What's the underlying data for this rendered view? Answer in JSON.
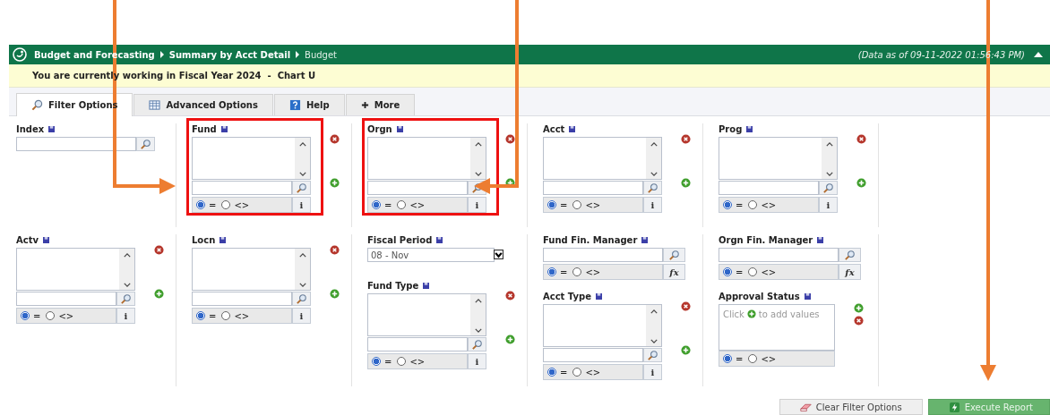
{
  "header": {
    "breadcrumb": [
      {
        "label": "Budget and Forecasting"
      },
      {
        "label": "Summary by Acct Detail"
      },
      {
        "label": "Budget"
      }
    ],
    "timestamp": "(Data as of 09-11-2022 01:56:43 PM)"
  },
  "notice": "You are currently working in Fiscal Year 2024  -  Chart U",
  "tabs": [
    {
      "kind": "filter",
      "label": "Filter Options",
      "selected": true
    },
    {
      "kind": "advanced",
      "label": "Advanced Options",
      "selected": false
    },
    {
      "kind": "help",
      "label": "Help",
      "selected": false
    },
    {
      "kind": "more",
      "label": "More",
      "selected": false
    }
  ],
  "rows": [
    {
      "cells": [
        {
          "filters": [
            {
              "kind": "lookup",
              "label": "Index"
            }
          ]
        },
        {
          "filters": [
            {
              "kind": "list",
              "label": "Fund",
              "highlighted": true,
              "operators": [
                {
                  "label": "=",
                  "selected": true
                },
                {
                  "label": "<>",
                  "selected": false
                }
              ],
              "info_button": "i"
            }
          ]
        },
        {
          "filters": [
            {
              "kind": "list",
              "label": "Orgn",
              "highlighted": true,
              "operators": [
                {
                  "label": "=",
                  "selected": true
                },
                {
                  "label": "<>",
                  "selected": false
                }
              ],
              "info_button": "i"
            }
          ]
        },
        {
          "filters": [
            {
              "kind": "list",
              "label": "Acct",
              "highlighted": false,
              "operators": [
                {
                  "label": "=",
                  "selected": true
                },
                {
                  "label": "<>",
                  "selected": false
                }
              ],
              "info_button": "i"
            }
          ]
        },
        {
          "filters": [
            {
              "kind": "list",
              "label": "Prog",
              "highlighted": false,
              "operators": [
                {
                  "label": "=",
                  "selected": true
                },
                {
                  "label": "<>",
                  "selected": false
                }
              ],
              "info_button": "i"
            }
          ]
        }
      ]
    },
    {
      "cells": [
        {
          "filters": [
            {
              "kind": "list",
              "label": "Actv",
              "highlighted": false,
              "operators": [
                {
                  "label": "=",
                  "selected": true
                },
                {
                  "label": "<>",
                  "selected": false
                }
              ],
              "info_button": "i"
            }
          ]
        },
        {
          "filters": [
            {
              "kind": "list",
              "label": "Locn",
              "highlighted": false,
              "operators": [
                {
                  "label": "=",
                  "selected": true
                },
                {
                  "label": "<>",
                  "selected": false
                }
              ],
              "info_button": "i"
            }
          ]
        },
        {
          "filters": [
            {
              "kind": "select",
              "label": "Fiscal Period",
              "value": "08 - Nov"
            },
            {
              "kind": "list",
              "label": "Fund Type",
              "highlighted": false,
              "operators": [
                {
                  "label": "=",
                  "selected": true
                },
                {
                  "label": "<>",
                  "selected": false
                }
              ],
              "info_button": "i"
            }
          ]
        },
        {
          "filters": [
            {
              "kind": "manager",
              "label": "Fund Fin. Manager",
              "operators": [
                {
                  "label": "=",
                  "selected": true
                },
                {
                  "label": "<>",
                  "selected": false
                }
              ],
              "formula_button": "fx"
            },
            {
              "kind": "list",
              "label": "Acct Type",
              "highlighted": false,
              "operators": [
                {
                  "label": "=",
                  "selected": true
                },
                {
                  "label": "<>",
                  "selected": false
                }
              ],
              "info_button": "i"
            }
          ]
        },
        {
          "filters": [
            {
              "kind": "manager",
              "label": "Orgn Fin. Manager",
              "operators": [
                {
                  "label": "=",
                  "selected": true
                },
                {
                  "label": "<>",
                  "selected": false
                }
              ],
              "formula_button": "fx"
            },
            {
              "kind": "approval",
              "label": "Approval Status",
              "hint_before": "Click",
              "hint_after": "to add values",
              "operators": [
                {
                  "label": "=",
                  "selected": true
                },
                {
                  "label": "<>",
                  "selected": false
                }
              ]
            }
          ]
        }
      ]
    }
  ],
  "buttons": [
    {
      "kind": "clear",
      "label": "Clear Filter Options"
    },
    {
      "kind": "execute",
      "label": "Execute Report"
    }
  ]
}
